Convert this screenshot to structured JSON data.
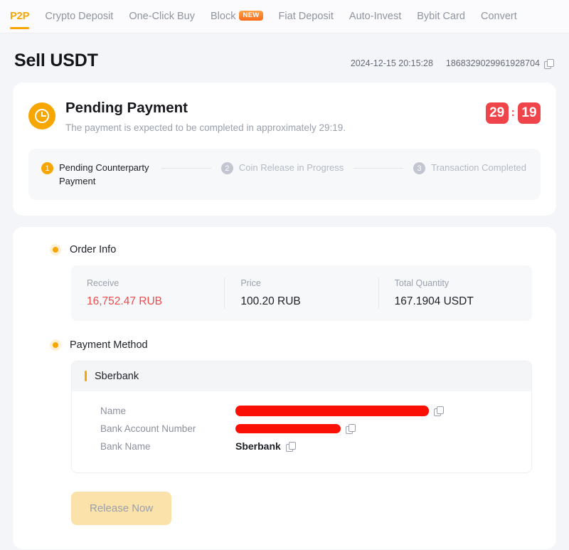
{
  "nav": {
    "tabs": [
      {
        "label": "P2P",
        "active": true,
        "badge": null
      },
      {
        "label": "Crypto Deposit",
        "active": false,
        "badge": null
      },
      {
        "label": "One-Click Buy",
        "active": false,
        "badge": null
      },
      {
        "label": "Block",
        "active": false,
        "badge": "NEW"
      },
      {
        "label": "Fiat Deposit",
        "active": false,
        "badge": null
      },
      {
        "label": "Auto-Invest",
        "active": false,
        "badge": null
      },
      {
        "label": "Bybit Card",
        "active": false,
        "badge": null
      },
      {
        "label": "Convert",
        "active": false,
        "badge": null
      }
    ]
  },
  "header": {
    "title": "Sell USDT",
    "timestamp": "2024-12-15 20:15:28",
    "order_id": "1868329029961928704",
    "copy_icon": "copy-icon"
  },
  "status": {
    "icon": "clock-icon",
    "title": "Pending Payment",
    "subtitle": "The payment is expected to be completed in approximately 29:19.",
    "countdown": {
      "minutes": "29",
      "separator": ":",
      "seconds": "19",
      "color": "#ef454a"
    }
  },
  "stepper": {
    "steps": [
      {
        "num": "1",
        "label": "Pending Counterparty Payment",
        "state": "active"
      },
      {
        "num": "2",
        "label": "Coin Release in Progress",
        "state": "idle"
      },
      {
        "num": "3",
        "label": "Transaction Completed",
        "state": "idle"
      }
    ]
  },
  "order_info": {
    "section_title": "Order Info",
    "cells": [
      {
        "label": "Receive",
        "value": "16,752.47 RUB",
        "accent": true
      },
      {
        "label": "Price",
        "value": "100.20 RUB",
        "accent": false
      },
      {
        "label": "Total Quantity",
        "value": "167.1904 USDT",
        "accent": false
      }
    ]
  },
  "payment_method": {
    "section_title": "Payment Method",
    "bank": "Sberbank",
    "rows": [
      {
        "key": "Name",
        "value": "",
        "redacted": true,
        "copy": true
      },
      {
        "key": "Bank Account Number",
        "value": "",
        "redacted": true,
        "copy": true
      },
      {
        "key": "Bank Name",
        "value": "Sberbank",
        "redacted": false,
        "copy": true
      }
    ]
  },
  "actions": {
    "release_label": "Release Now"
  },
  "colors": {
    "brand": "#f7a600",
    "danger": "#ef454a",
    "accent_red": "#f04b4b",
    "page_bg": "#f4f5f9"
  }
}
